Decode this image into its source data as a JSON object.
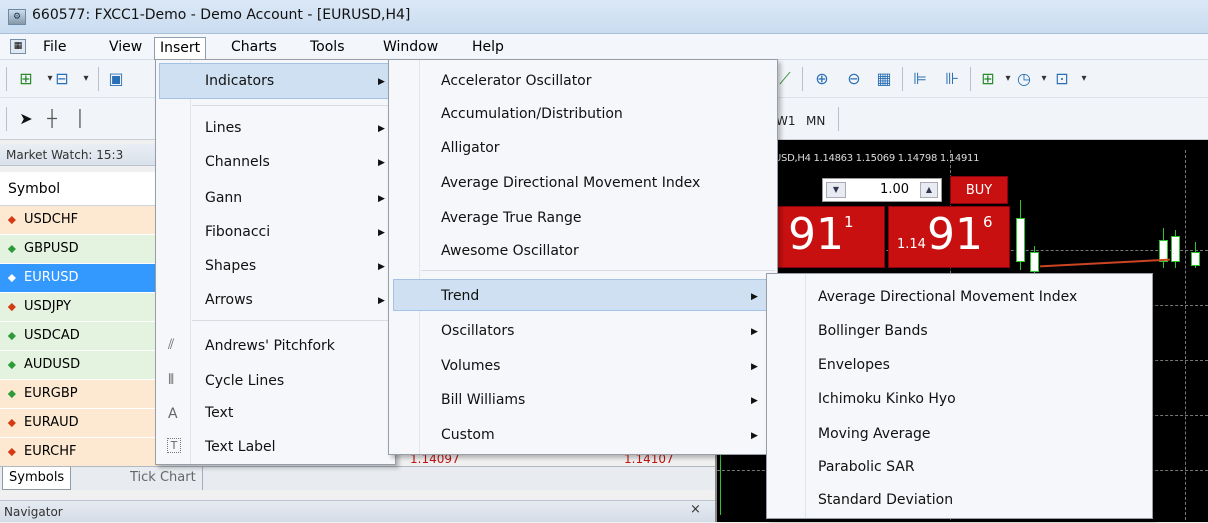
{
  "window": {
    "title": "660577: FXCC1-Demo - Demo Account - [EURUSD,H4]",
    "app_icon": "mt4-app-icon"
  },
  "menubar": {
    "items": [
      "File",
      "View",
      "Insert",
      "Charts",
      "Tools",
      "Window",
      "Help"
    ],
    "active": "Insert"
  },
  "toolbar2": {
    "timeframes": [
      "W1",
      "MN"
    ]
  },
  "market_watch": {
    "header": "Market Watch: 15:3",
    "column": "Symbol",
    "rows": [
      {
        "symbol": "USDCHF",
        "dir": "down"
      },
      {
        "symbol": "GBPUSD",
        "dir": "up"
      },
      {
        "symbol": "EURUSD",
        "dir": "down"
      },
      {
        "symbol": "USDJPY",
        "dir": "down"
      },
      {
        "symbol": "USDCAD",
        "dir": "up"
      },
      {
        "symbol": "AUDUSD",
        "dir": "up"
      },
      {
        "symbol": "EURGBP",
        "dir": "up"
      },
      {
        "symbol": "EURAUD",
        "dir": "down"
      },
      {
        "symbol": "EURCHF",
        "dir": "down"
      }
    ],
    "behind_values": [
      "1.14097",
      "1.14107"
    ]
  },
  "tabs": {
    "items": [
      "Symbols",
      "Tick Chart"
    ]
  },
  "navigator": {
    "title": "Navigator",
    "close": "×"
  },
  "chart": {
    "info": "USD,H4 1.14863 1.15069 1.14798 1.14911",
    "quantity": "1.00",
    "buy_label": "BUY",
    "sell_price": {
      "big": "91",
      "sup": "1"
    },
    "buy_price": {
      "prefix": "1.14",
      "big": "91",
      "sup": "6"
    }
  },
  "insert_menu": {
    "items": [
      {
        "label": "Indicators",
        "submenu": true,
        "highlighted": true
      },
      {
        "label": "Lines",
        "submenu": true
      },
      {
        "label": "Channels",
        "submenu": true
      },
      {
        "label": "Gann",
        "submenu": true
      },
      {
        "label": "Fibonacci",
        "submenu": true
      },
      {
        "label": "Shapes",
        "submenu": true
      },
      {
        "label": "Arrows",
        "submenu": true
      },
      {
        "label": "Andrews' Pitchfork",
        "icon": "pitchfork-icon"
      },
      {
        "label": "Cycle Lines",
        "icon": "cycle-lines-icon"
      },
      {
        "label": "Text",
        "icon": "text-icon"
      },
      {
        "label": "Text Label",
        "icon": "text-label-icon"
      }
    ]
  },
  "indicators_menu": {
    "items": [
      {
        "label": "Accelerator Oscillator"
      },
      {
        "label": "Accumulation/Distribution"
      },
      {
        "label": "Alligator"
      },
      {
        "label": "Average Directional Movement Index"
      },
      {
        "label": "Average True Range"
      },
      {
        "label": "Awesome Oscillator"
      },
      {
        "label": "Trend",
        "submenu": true,
        "highlighted": true
      },
      {
        "label": "Oscillators",
        "submenu": true
      },
      {
        "label": "Volumes",
        "submenu": true
      },
      {
        "label": "Bill Williams",
        "submenu": true
      },
      {
        "label": "Custom",
        "submenu": true
      }
    ]
  },
  "trend_menu": {
    "items": [
      {
        "label": "Average Directional Movement Index"
      },
      {
        "label": "Bollinger Bands"
      },
      {
        "label": "Envelopes"
      },
      {
        "label": "Ichimoku Kinko Hyo"
      },
      {
        "label": "Moving Average"
      },
      {
        "label": "Parabolic SAR"
      },
      {
        "label": "Standard Deviation"
      }
    ]
  }
}
